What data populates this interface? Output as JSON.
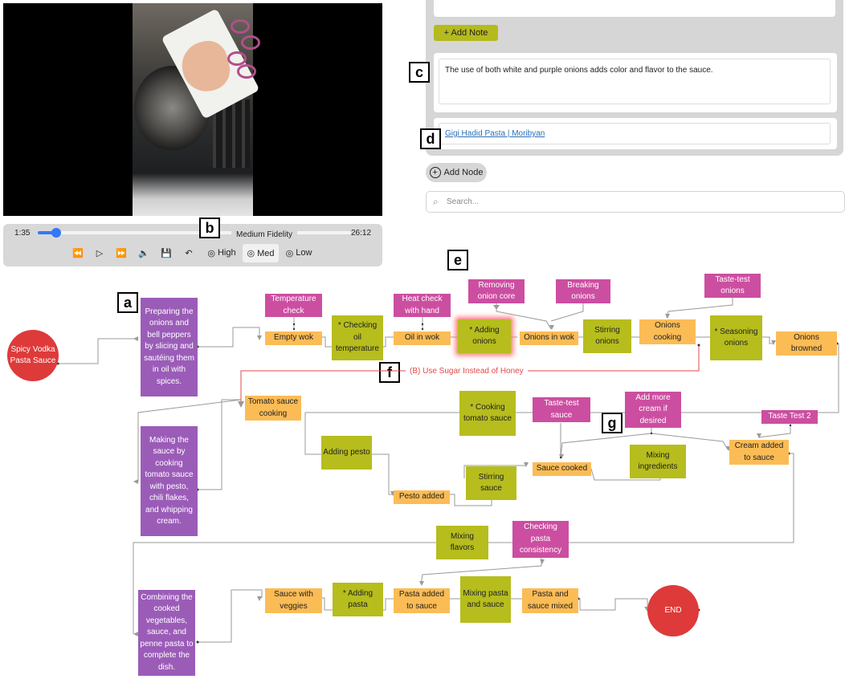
{
  "player": {
    "current_time": "1:35",
    "total_time": "26:12",
    "progress": 0.06,
    "fidelity_label": "Medium Fidelity",
    "buttons": {
      "rewind_icon": "⏪",
      "play_icon": "▷",
      "forward_icon": "⏩",
      "volume_icon": "🔈",
      "save_icon": "💾",
      "undo_icon": "↶"
    },
    "fidelity_options": [
      "High",
      "Med",
      "Low"
    ],
    "selected_fidelity": "Med"
  },
  "notes": {
    "add_note_label": "+ Add Note",
    "note_text": "The use of both white and purple onions adds color and flavor to the sauce.",
    "link_text": "Gigi Hadid Pasta | Moribyan"
  },
  "add_node_label": "Add Node",
  "search": {
    "placeholder": "Search..."
  },
  "markers": [
    "a",
    "b",
    "c",
    "d",
    "e",
    "f",
    "g"
  ],
  "edge_label": "(B) Use Sugar Instead of Honey",
  "colors": {
    "pink": "#cc4ea1",
    "olive": "#b6bd1d",
    "orange": "#fbbc56",
    "purple": "#9b5cb8",
    "red": "#de3a3a",
    "accent_blue": "#3478f6"
  },
  "graph": {
    "start": "Spicy Vodka Pasta Sauce",
    "end": "END",
    "sections": {
      "s1": "Preparing the onions and bell peppers by slicing and sautéing them in oil with spices.",
      "s2": "Making the sauce by cooking tomato sauce with pesto, chili flakes, and whipping cream.",
      "s3": "Combining the cooked vegetables, sauce, and penne pasta to complete the dish."
    },
    "nodes": {
      "temperature_check": "Temperature check",
      "empty_wok": "Empty wok",
      "checking_oil": "* Checking oil temperature",
      "heat_check": "Heat check with hand",
      "oil_in_wok": "Oil in wok",
      "adding_onions": "* Adding onions",
      "removing_core": "Removing onion core",
      "onions_in_wok": "Onions in wok",
      "breaking_onions": "Breaking onions",
      "stirring_onions": "Stirring onions",
      "onions_cooking": "Onions cooking",
      "taste_test_onions": "Taste-test onions",
      "seasoning_onions": "* Seasoning onions",
      "onions_browned": "Onions browned",
      "tomato_sauce_cooking": "Tomato sauce cooking",
      "cooking_tomato_sauce": "* Cooking tomato sauce",
      "adding_pesto": "Adding pesto",
      "pesto_added": "Pesto added",
      "stirring_sauce": "Stirring sauce",
      "taste_test_sauce": "Taste-test sauce",
      "sauce_cooked": "Sauce cooked",
      "add_more_cream": "Add more cream if desired",
      "mixing_ingredients": "Mixing ingredients",
      "taste_test_2": "Taste Test 2",
      "cream_added": "Cream added to sauce",
      "mixing_flavors": "Mixing flavors",
      "checking_consistency": "Checking pasta consistency",
      "sauce_with_veggies": "Sauce with veggies",
      "adding_pasta": "* Adding pasta",
      "pasta_added": "Pasta added to sauce",
      "mixing_pasta": "Mixing pasta and sauce",
      "pasta_and_sauce": "Pasta and sauce mixed"
    }
  }
}
